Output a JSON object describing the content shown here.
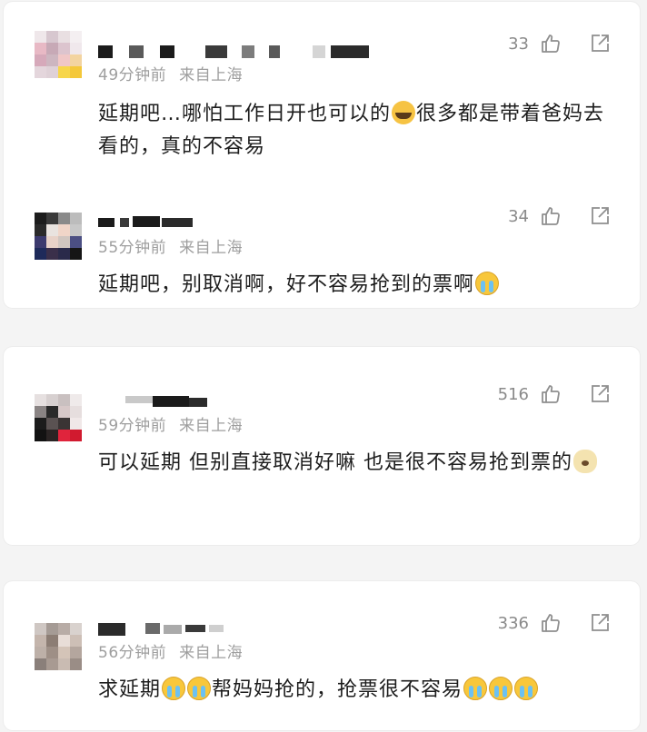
{
  "comments": [
    {
      "likes": "33",
      "time": "49分钟前",
      "location": "来自上海",
      "text_before": "延期吧…哪怕工作日开也可以的",
      "emoji_1": "laughing-crying-emoji",
      "text_after": "很多都是带着爸妈去看的，真的不容易"
    },
    {
      "likes": "34",
      "time": "55分钟前",
      "location": "来自上海",
      "text_before": "延期吧，别取消啊，好不容易抢到的票啊",
      "emoji_1": "crying-emoji"
    },
    {
      "likes": "516",
      "time": "59分钟前",
      "location": "来自上海",
      "text_before": "可以延期 但别直接取消好嘛 也是很不容易抢到票的",
      "emoji_1": "dog-emoji"
    },
    {
      "likes": "336",
      "time": "56分钟前",
      "location": "来自上海",
      "text_before": "求延期",
      "text_mid": "帮妈妈抢的，抢票很不容易",
      "emoji_1": "crying-emoji"
    }
  ],
  "icons": {
    "like": "thumbs-up-icon",
    "share": "share-icon"
  },
  "colors": {
    "meta_text": "#9e9e9e",
    "body_text": "#1d1d1d",
    "card_bg": "#ffffff",
    "page_bg": "#f4f4f4"
  }
}
